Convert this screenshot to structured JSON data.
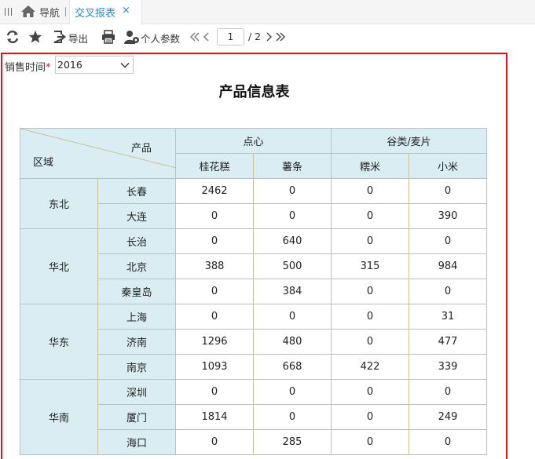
{
  "tabbar": {
    "nav_label": "导航",
    "active_tab_label": "交叉报表",
    "close_glyph": "×"
  },
  "toolbar": {
    "export_label": "导出",
    "params_label": "个人参数",
    "current_page": "1",
    "total_pages": "/ 2",
    "icons": [
      "refresh-icon",
      "star-icon",
      "export-icon",
      "print-icon",
      "user-params-icon",
      "first-page-icon",
      "prev-page-icon",
      "next-page-icon",
      "last-page-icon"
    ]
  },
  "params": {
    "label": "销售时间",
    "required_mark": "*",
    "year_value": "2016"
  },
  "report": {
    "title": "产品信息表",
    "corner_product": "产品",
    "corner_region": "区域",
    "groups": [
      {
        "name": "点心",
        "items": [
          "桂花糕",
          "薯条"
        ]
      },
      {
        "name": "谷类/麦片",
        "items": [
          "糯米",
          "小米"
        ]
      }
    ],
    "regions": [
      {
        "name": "东北",
        "cities": [
          {
            "name": "长春",
            "values": [
              "2462",
              "0",
              "0",
              "0"
            ]
          },
          {
            "name": "大连",
            "values": [
              "0",
              "0",
              "0",
              "390"
            ]
          }
        ]
      },
      {
        "name": "华北",
        "cities": [
          {
            "name": "长治",
            "values": [
              "0",
              "640",
              "0",
              "0"
            ]
          },
          {
            "name": "北京",
            "values": [
              "388",
              "500",
              "315",
              "984"
            ]
          },
          {
            "name": "秦皇岛",
            "values": [
              "0",
              "384",
              "0",
              "0"
            ]
          }
        ]
      },
      {
        "name": "华东",
        "cities": [
          {
            "name": "上海",
            "values": [
              "0",
              "0",
              "0",
              "31"
            ]
          },
          {
            "name": "济南",
            "values": [
              "1296",
              "480",
              "0",
              "477"
            ]
          },
          {
            "name": "南京",
            "values": [
              "1093",
              "668",
              "422",
              "339"
            ]
          }
        ]
      },
      {
        "name": "华南",
        "cities": [
          {
            "name": "深圳",
            "values": [
              "0",
              "0",
              "0",
              "0"
            ]
          },
          {
            "name": "厦门",
            "values": [
              "1814",
              "0",
              "0",
              "249"
            ]
          },
          {
            "name": "海口",
            "values": [
              "0",
              "285",
              "0",
              "0"
            ]
          }
        ]
      }
    ]
  },
  "colors": {
    "accent": "#1f8fd6",
    "highlight_border": "#e0141e",
    "header_bg": "#daedf2",
    "grid_line": "#c9c19a"
  }
}
